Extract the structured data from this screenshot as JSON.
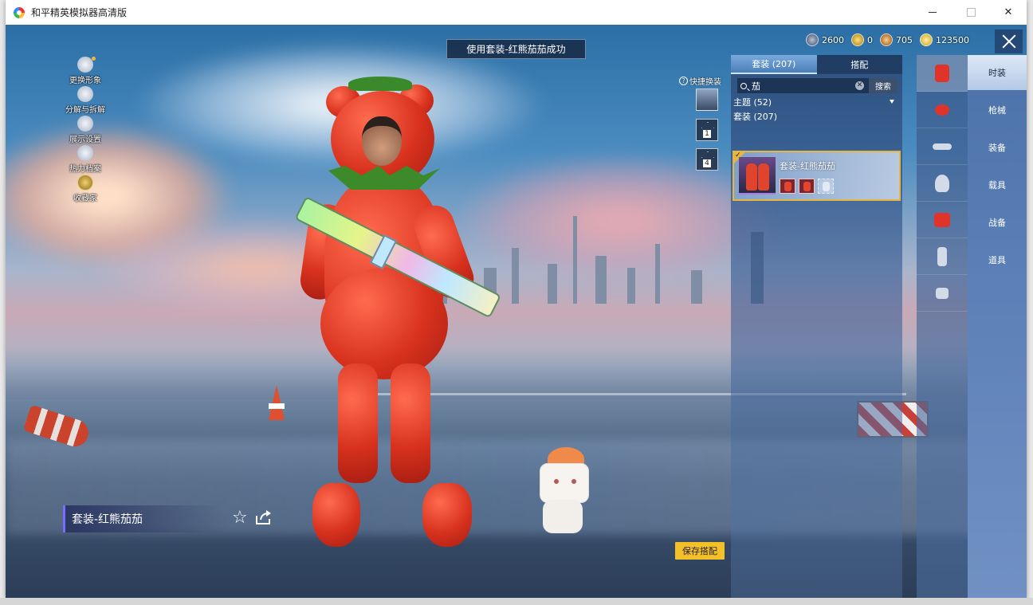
{
  "window": {
    "title": "和平精英模拟器高清版"
  },
  "toast": "使用套装-红熊茄茄成功",
  "currencies": [
    {
      "icon": "silver-coin-icon",
      "value": "2600"
    },
    {
      "icon": "gold-token-icon",
      "value": "0"
    },
    {
      "icon": "bronze-coupon-icon",
      "value": "705"
    },
    {
      "icon": "gold-coin-icon",
      "value": "123500"
    }
  ],
  "left_menu": [
    {
      "icon": "change-appearance-icon",
      "label": "更换形象"
    },
    {
      "icon": "decompose-icon",
      "label": "分解与拆解"
    },
    {
      "icon": "eye-icon",
      "label": "展示设置"
    },
    {
      "icon": "flame-icon",
      "label": "热力档案"
    },
    {
      "icon": "collector-badge-icon",
      "label": "收藏家"
    }
  ],
  "quick_change": {
    "label": "快捷换装",
    "slots": [
      "",
      "1",
      "4"
    ]
  },
  "panel": {
    "tabs": [
      "套装 (207)",
      "搭配"
    ],
    "search": {
      "value": "茄",
      "button": "搜索"
    },
    "theme_row": "主题 (52)",
    "set_row": "套装 (207)",
    "item": {
      "name": "套装-红熊茄茄"
    }
  },
  "categories": [
    "时装",
    "枪械",
    "装备",
    "载具",
    "战备",
    "道具"
  ],
  "category_icons": [
    "outfit-icon",
    "weapon-skin-icon",
    "goggles-icon",
    "helmet-icon",
    "top-icon",
    "pants-icon",
    "shoes-icon"
  ],
  "outfit_name": "套装-红熊茄茄",
  "save_button": "保存搭配"
}
